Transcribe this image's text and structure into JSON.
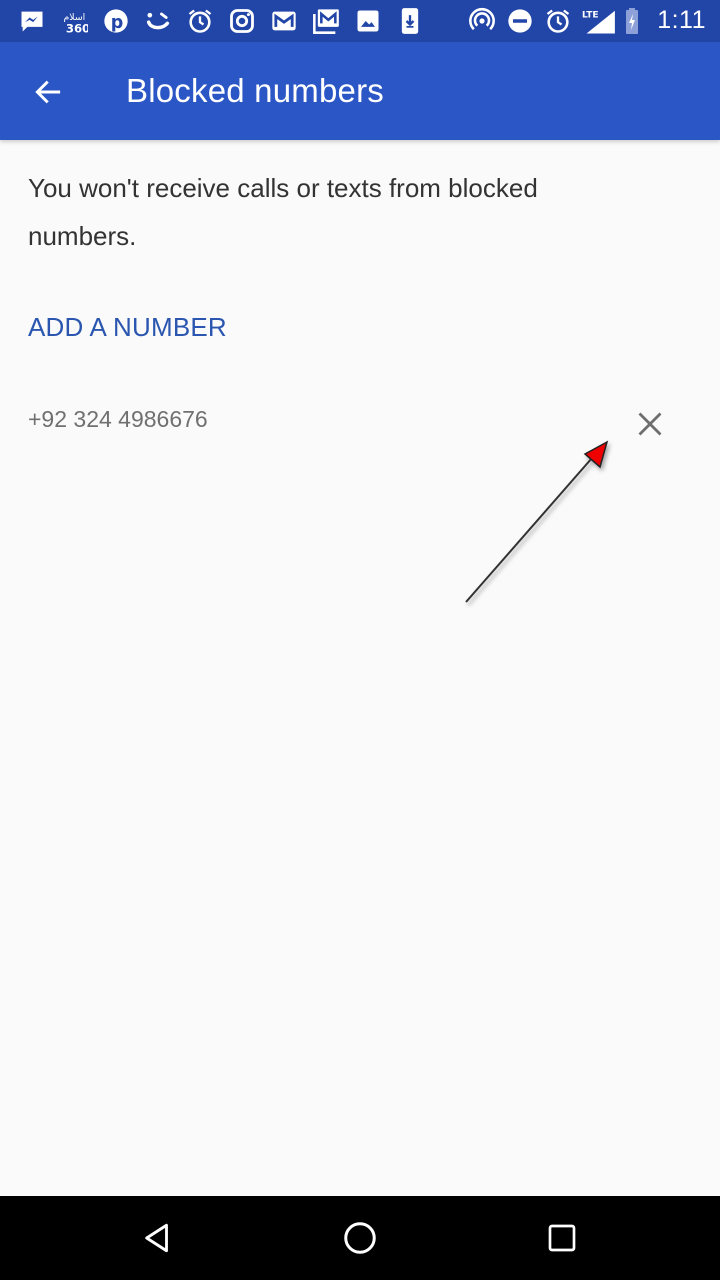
{
  "status_bar": {
    "left_icons": [
      "messenger-icon",
      "islam360-icon",
      "pinterest-icon",
      "smile-app-icon",
      "alarm-icon",
      "instagram-icon",
      "gmail-icon",
      "gmail-stack-icon",
      "gallery-icon",
      "download-icon"
    ],
    "right_icons": [
      "hotspot-icon",
      "do-not-disturb-icon",
      "alarm-icon",
      "lte-signal-icon",
      "battery-charging-icon"
    ],
    "network_label": "LTE",
    "time": "1:11"
  },
  "app_bar": {
    "back_icon": "arrow-left-icon",
    "title": "Blocked numbers",
    "color": "#2b56c5"
  },
  "content": {
    "description": "You won't receive calls or texts from blocked numbers.",
    "add_number_label": "ADD A NUMBER",
    "accent_color": "#2b56b0",
    "blocked_numbers": [
      {
        "number": "+92 324 4986676",
        "remove_icon": "close-icon"
      }
    ]
  },
  "annotation": {
    "type": "arrow",
    "points_to": "remove-blocked-number-button",
    "head_color": "#ee0000"
  },
  "nav_bar": {
    "buttons": [
      "back-triangle-icon",
      "home-circle-icon",
      "recents-square-icon"
    ]
  }
}
